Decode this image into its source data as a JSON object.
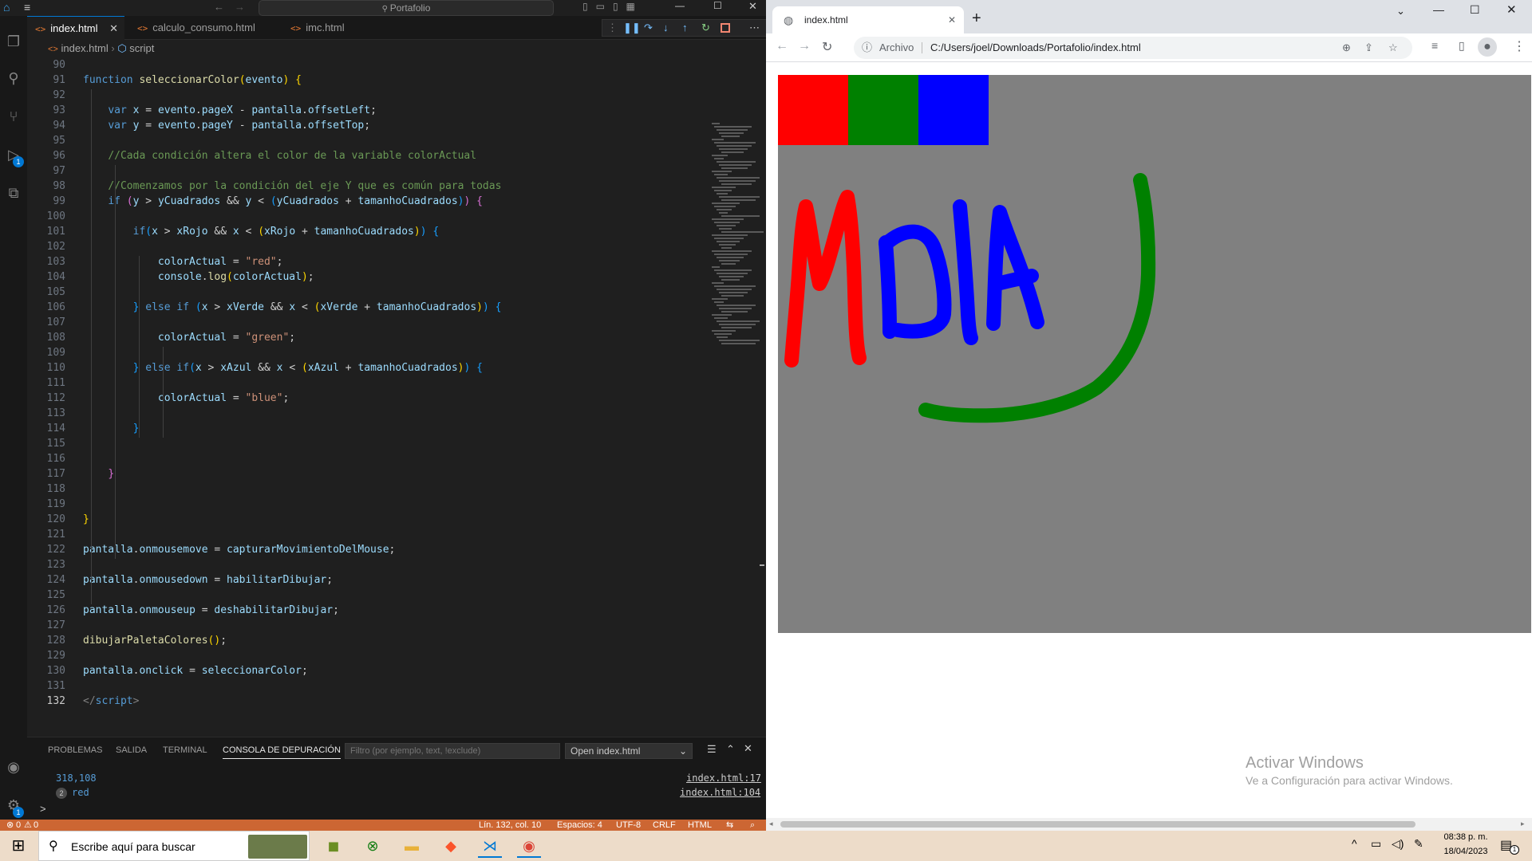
{
  "vscode": {
    "title_search": "Portafolio",
    "tabs": [
      {
        "label": "index.html",
        "active": true
      },
      {
        "label": "calculo_consumo.html",
        "active": false
      },
      {
        "label": "imc.html",
        "active": false
      }
    ],
    "breadcrumb": {
      "file": "index.html",
      "symbol": "script"
    },
    "code_lines": [
      {
        "n": "90",
        "html": ""
      },
      {
        "n": "91",
        "html": "<span class='kw'>function</span> <span class='fn'>seleccionarColor</span><span class='br3'>(</span><span class='var'>evento</span><span class='br3'>)</span> <span class='br3'>{</span>"
      },
      {
        "n": "92",
        "html": ""
      },
      {
        "n": "93",
        "html": "    <span class='kw'>var</span> <span class='var'>x</span> = <span class='var'>evento</span>.<span class='var'>pageX</span> - <span class='var'>pantalla</span>.<span class='var'>offsetLeft</span>;"
      },
      {
        "n": "94",
        "html": "    <span class='kw'>var</span> <span class='var'>y</span> = <span class='var'>evento</span>.<span class='var'>pageY</span> - <span class='var'>pantalla</span>.<span class='var'>offsetTop</span>;"
      },
      {
        "n": "95",
        "html": ""
      },
      {
        "n": "96",
        "html": "    <span class='cm'>//Cada condición altera el color de la variable colorActual</span>"
      },
      {
        "n": "97",
        "html": ""
      },
      {
        "n": "98",
        "html": "    <span class='cm'>//Comenzamos por la condición del eje Y que es común para todas</span>"
      },
      {
        "n": "99",
        "html": "    <span class='kw'>if</span> <span class='br1'>(</span><span class='var'>y</span> &gt; <span class='var'>yCuadrados</span> &amp;&amp; <span class='var'>y</span> &lt; <span class='br2'>(</span><span class='var'>yCuadrados</span> + <span class='var'>tamanhoCuadrados</span><span class='br2'>)</span><span class='br1'>)</span> <span class='br1'>{</span>"
      },
      {
        "n": "100",
        "html": ""
      },
      {
        "n": "101",
        "html": "        <span class='kw'>if</span><span class='br2'>(</span><span class='var'>x</span> &gt; <span class='var'>xRojo</span> &amp;&amp; <span class='var'>x</span> &lt; <span class='br3'>(</span><span class='var'>xRojo</span> + <span class='var'>tamanhoCuadrados</span><span class='br3'>)</span><span class='br2'>)</span> <span class='br2'>{</span>"
      },
      {
        "n": "102",
        "html": ""
      },
      {
        "n": "103",
        "html": "            <span class='var'>colorActual</span> = <span class='str'>\"red\"</span>;"
      },
      {
        "n": "104",
        "html": "            <span class='var'>console</span>.<span class='fn'>log</span><span class='br3'>(</span><span class='var'>colorActual</span><span class='br3'>)</span>;"
      },
      {
        "n": "105",
        "html": ""
      },
      {
        "n": "106",
        "html": "        <span class='br2'>}</span> <span class='kw'>else if</span> <span class='br2'>(</span><span class='var'>x</span> &gt; <span class='var'>xVerde</span> &amp;&amp; <span class='var'>x</span> &lt; <span class='br3'>(</span><span class='var'>xVerde</span> + <span class='var'>tamanhoCuadrados</span><span class='br3'>)</span><span class='br2'>)</span> <span class='br2'>{</span>"
      },
      {
        "n": "107",
        "html": ""
      },
      {
        "n": "108",
        "html": "            <span class='var'>colorActual</span> = <span class='str'>\"green\"</span>;"
      },
      {
        "n": "109",
        "html": ""
      },
      {
        "n": "110",
        "html": "        <span class='br2'>}</span> <span class='kw'>else if</span><span class='br2'>(</span><span class='var'>x</span> &gt; <span class='var'>xAzul</span> &amp;&amp; <span class='var'>x</span> &lt; <span class='br3'>(</span><span class='var'>xAzul</span> + <span class='var'>tamanhoCuadrados</span><span class='br3'>)</span><span class='br2'>)</span> <span class='br2'>{</span>"
      },
      {
        "n": "111",
        "html": ""
      },
      {
        "n": "112",
        "html": "            <span class='var'>colorActual</span> = <span class='str'>\"blue\"</span>;"
      },
      {
        "n": "113",
        "html": ""
      },
      {
        "n": "114",
        "html": "        <span class='br2'>}</span>"
      },
      {
        "n": "115",
        "html": ""
      },
      {
        "n": "116",
        "html": ""
      },
      {
        "n": "117",
        "html": "    <span class='br1'>}</span>"
      },
      {
        "n": "118",
        "html": ""
      },
      {
        "n": "119",
        "html": ""
      },
      {
        "n": "120",
        "html": "<span class='br3'>}</span>"
      },
      {
        "n": "121",
        "html": ""
      },
      {
        "n": "122",
        "html": "<span class='var'>pantalla</span>.<span class='var'>onmousemove</span> = <span class='var'>capturarMovimientoDelMouse</span>;"
      },
      {
        "n": "123",
        "html": ""
      },
      {
        "n": "124",
        "html": "<span class='var'>pantalla</span>.<span class='var'>onmousedown</span> = <span class='var'>habilitarDibujar</span>;"
      },
      {
        "n": "125",
        "html": ""
      },
      {
        "n": "126",
        "html": "<span class='var'>pantalla</span>.<span class='var'>onmouseup</span> = <span class='var'>deshabilitarDibujar</span>;"
      },
      {
        "n": "127",
        "html": ""
      },
      {
        "n": "128",
        "html": "<span class='fn'>dibujarPaletaColores</span><span class='br3'>()</span>;"
      },
      {
        "n": "129",
        "html": ""
      },
      {
        "n": "130",
        "html": "<span class='var'>pantalla</span>.<span class='var'>onclick</span> = <span class='var'>seleccionarColor</span>;"
      },
      {
        "n": "131",
        "html": ""
      },
      {
        "n": "132",
        "html": "<span class='tag'>&lt;/</span><span class='tagn'>script</span><span class='tag'>&gt;</span>"
      }
    ],
    "panel": {
      "tabs": [
        "PROBLEMAS",
        "SALIDA",
        "TERMINAL",
        "CONSOLA DE DEPURACIÓN"
      ],
      "filter_placeholder": "Filtro (por ejemplo, text, !exclude)",
      "session": "Open index.html",
      "lines": [
        {
          "count": "",
          "text": "318,108",
          "link": "index.html:17"
        },
        {
          "count": "2",
          "text": "red",
          "link": "index.html:104"
        }
      ],
      "prompt": ">"
    },
    "status": {
      "errors": "0",
      "warnings": "0",
      "position": "Lín. 132, col. 10",
      "spaces": "Espacios: 4",
      "encoding": "UTF-8",
      "eol": "CRLF",
      "language": "HTML"
    },
    "debug_badge": "1",
    "account_badge": "1"
  },
  "chrome": {
    "tab_title": "index.html",
    "new_tab": "+",
    "scheme_label": "Archivo",
    "url": "C:/Users/joel/Downloads/Portafolio/index.html",
    "canvas_bg": "#808080",
    "palette": [
      "#ff0000",
      "#008000",
      "#0000ff"
    ],
    "drawing_colors": {
      "letters_m": "#ff0000",
      "letters_dia": "#0000ff",
      "smile": "#008000"
    }
  },
  "watermark": {
    "title": "Activar Windows",
    "subtitle": "Ve a Configuración para activar Windows."
  },
  "taskbar": {
    "search_placeholder": "Escribe aquí para buscar",
    "time": "08:38 p. m.",
    "date": "18/04/2023",
    "notif_count": "1"
  }
}
